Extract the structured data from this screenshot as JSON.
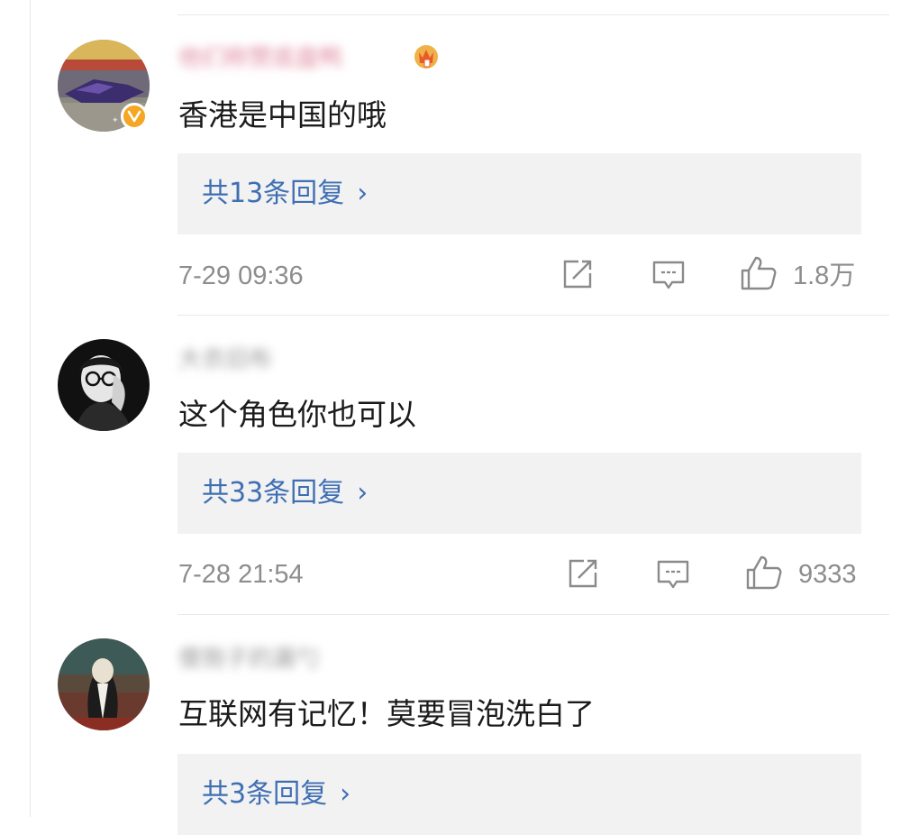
{
  "comments": [
    {
      "username": "他们称赞底盘鸭",
      "content": "香港是中国的哦",
      "reply_link": "共13条回复",
      "time": "7-29 09:36",
      "likes": "1.8万",
      "verified": true,
      "has_badge": true
    },
    {
      "username": "大衣旧布",
      "content": "这个角色你也可以",
      "reply_link": "共33条回复",
      "time": "7-28 21:54",
      "likes": "9333",
      "verified": false,
      "has_badge": false
    },
    {
      "username": "傻狍子的漏勺",
      "content": "互联网有记忆！莫要冒泡洗白了",
      "reply_link": "共3条回复",
      "verified": false,
      "has_badge": false
    }
  ],
  "icons": {
    "share": "share-icon",
    "comment": "comment-icon",
    "like": "thumbs-up-icon",
    "chevron": "chevron-right-icon",
    "verified": "verified-v-icon",
    "badge": "crown-badge-icon"
  },
  "colors": {
    "link": "#3f6fb3",
    "reply_bg": "#f2f2f2",
    "meta": "#8d8d8d",
    "verified": "#f5a623"
  },
  "chevron_glyph": "›"
}
